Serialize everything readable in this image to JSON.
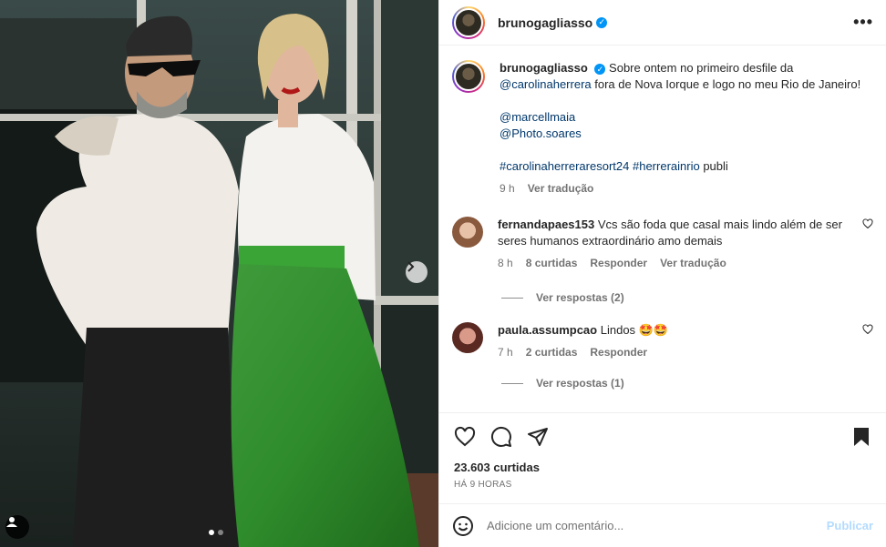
{
  "media": {
    "dots": 2,
    "active_dot": 0,
    "icons": {
      "next": "chevron-right-icon",
      "tagged": "user-tag-icon"
    }
  },
  "header": {
    "username": "brunogagliasso",
    "verified": true,
    "more": "•••"
  },
  "caption": {
    "username": "brunogagliasso",
    "text": "Sobre ontem no primeiro desfile da",
    "mention1": "@carolinaherrera",
    "text2": "fora de Nova Iorque e logo no meu Rio de Janeiro!",
    "credit1": "@marcellmaia",
    "credit2": "@Photo.soares",
    "hashtag1": "#carolinaherreraresort24",
    "hashtag2": "#herrerainrio",
    "tail": "publi",
    "time": "9 h",
    "translate": "Ver tradução"
  },
  "comments": [
    {
      "username": "fernandapaes153",
      "text": "Vcs são foda que casal mais lindo além de ser seres humanos extraordinário amo demais",
      "time": "8 h",
      "likes": "8 curtidas",
      "reply": "Responder",
      "translate": "Ver tradução",
      "replies": "Ver respostas (2)"
    },
    {
      "username": "paula.assumpcao",
      "text": "Lindos 🤩🤩",
      "time": "7 h",
      "likes": "2 curtidas",
      "reply": "Responder",
      "replies": "Ver respostas (1)"
    }
  ],
  "actions": {
    "likes": "23.603 curtidas",
    "timestamp": "HÁ 9 HORAS"
  },
  "add_comment": {
    "placeholder": "Adicione um comentário...",
    "post": "Publicar"
  },
  "colors": {
    "accent": "#0095f6",
    "link": "#00376b",
    "muted": "#737373",
    "post_disabled": "#b3dbff"
  }
}
